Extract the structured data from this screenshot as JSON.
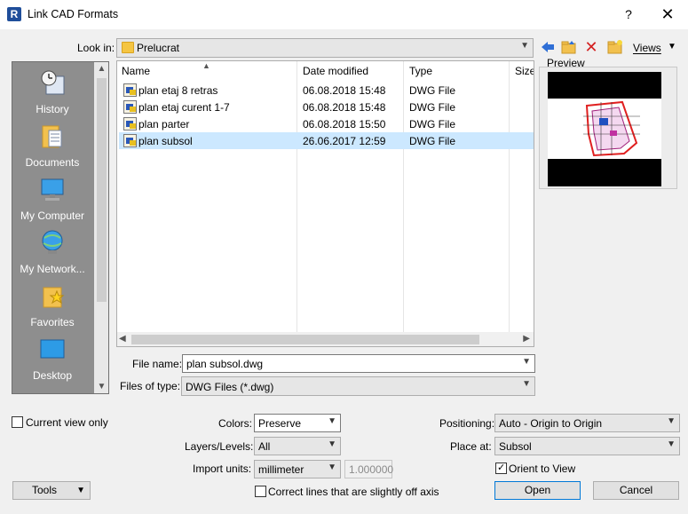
{
  "window": {
    "title": "Link CAD Formats",
    "help": "?",
    "close": "✕"
  },
  "lookin": {
    "label": "Look in:",
    "value": "Prelucrat",
    "views_label": "Views"
  },
  "places": [
    {
      "label": "History",
      "icon": "history-icon"
    },
    {
      "label": "Documents",
      "icon": "documents-icon"
    },
    {
      "label": "My Computer",
      "icon": "computer-icon"
    },
    {
      "label": "My Network...",
      "icon": "network-icon"
    },
    {
      "label": "Favorites",
      "icon": "favorites-icon"
    },
    {
      "label": "Desktop",
      "icon": "desktop-icon"
    }
  ],
  "filelist": {
    "columns": [
      "Name",
      "Date modified",
      "Type",
      "Size"
    ],
    "rows": [
      {
        "name": "plan etaj 8 retras",
        "date": "06.08.2018 15:48",
        "type": "DWG File",
        "selected": false
      },
      {
        "name": "plan etaj curent 1-7",
        "date": "06.08.2018 15:48",
        "type": "DWG File",
        "selected": false
      },
      {
        "name": "plan parter",
        "date": "06.08.2018 15:50",
        "type": "DWG File",
        "selected": false
      },
      {
        "name": "plan subsol",
        "date": "26.06.2017 12:59",
        "type": "DWG File",
        "selected": true
      }
    ]
  },
  "preview": {
    "label": "Preview"
  },
  "file_name": {
    "label": "File name:",
    "value": "plan subsol.dwg"
  },
  "file_type": {
    "label": "Files of type:",
    "value": "DWG Files  (*.dwg)"
  },
  "options": {
    "current_view_only": {
      "label": "Current view only",
      "checked": false
    },
    "colors": {
      "label": "Colors:",
      "value": "Preserve"
    },
    "layers": {
      "label": "Layers/Levels:",
      "value": "All"
    },
    "import_units": {
      "label": "Import units:",
      "value": "millimeter",
      "scale": "1.000000"
    },
    "correct_lines": {
      "label": "Correct lines that are slightly off axis",
      "checked": false
    },
    "positioning": {
      "label": "Positioning:",
      "value": "Auto - Origin to Origin"
    },
    "place_at": {
      "label": "Place at:",
      "value": "Subsol"
    },
    "orient_to_view": {
      "label": "Orient to View",
      "checked": true
    }
  },
  "buttons": {
    "tools": "Tools",
    "open": "Open",
    "cancel": "Cancel"
  }
}
